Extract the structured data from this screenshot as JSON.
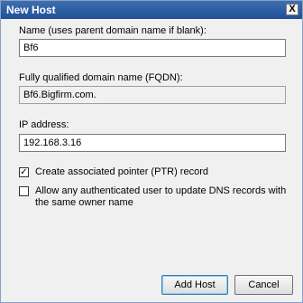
{
  "window": {
    "title": "New Host",
    "close_glyph": "X"
  },
  "fields": {
    "name_label": "Name (uses parent domain name if blank):",
    "name_value": "Bf6",
    "fqdn_label": "Fully qualified domain name (FQDN):",
    "fqdn_value": "Bf6.Bigfirm.com.",
    "ip_label": "IP address:",
    "ip_value": "192.168.3.16"
  },
  "checkboxes": [
    {
      "label": "Create associated pointer (PTR) record",
      "checked": true,
      "mark": "✓"
    },
    {
      "label": "Allow any authenticated user to update DNS records with the same owner name",
      "checked": false,
      "mark": ""
    }
  ],
  "buttons": {
    "add_host": "Add Host",
    "cancel": "Cancel"
  }
}
